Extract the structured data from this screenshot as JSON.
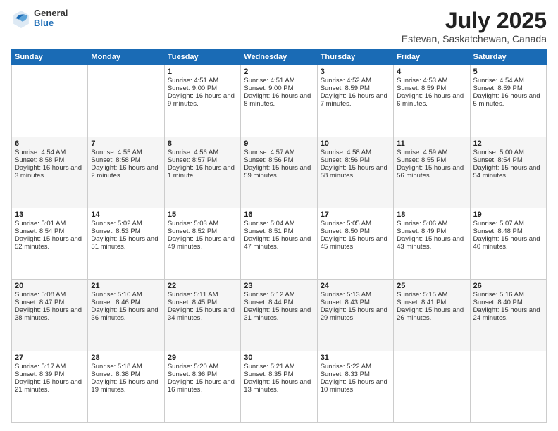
{
  "logo": {
    "general": "General",
    "blue": "Blue"
  },
  "title": "July 2025",
  "subtitle": "Estevan, Saskatchewan, Canada",
  "days_header": [
    "Sunday",
    "Monday",
    "Tuesday",
    "Wednesday",
    "Thursday",
    "Friday",
    "Saturday"
  ],
  "weeks": [
    [
      {
        "day": "",
        "info": ""
      },
      {
        "day": "",
        "info": ""
      },
      {
        "day": "1",
        "info": "Sunrise: 4:51 AM\nSunset: 9:00 PM\nDaylight: 16 hours and 9 minutes."
      },
      {
        "day": "2",
        "info": "Sunrise: 4:51 AM\nSunset: 9:00 PM\nDaylight: 16 hours and 8 minutes."
      },
      {
        "day": "3",
        "info": "Sunrise: 4:52 AM\nSunset: 8:59 PM\nDaylight: 16 hours and 7 minutes."
      },
      {
        "day": "4",
        "info": "Sunrise: 4:53 AM\nSunset: 8:59 PM\nDaylight: 16 hours and 6 minutes."
      },
      {
        "day": "5",
        "info": "Sunrise: 4:54 AM\nSunset: 8:59 PM\nDaylight: 16 hours and 5 minutes."
      }
    ],
    [
      {
        "day": "6",
        "info": "Sunrise: 4:54 AM\nSunset: 8:58 PM\nDaylight: 16 hours and 3 minutes."
      },
      {
        "day": "7",
        "info": "Sunrise: 4:55 AM\nSunset: 8:58 PM\nDaylight: 16 hours and 2 minutes."
      },
      {
        "day": "8",
        "info": "Sunrise: 4:56 AM\nSunset: 8:57 PM\nDaylight: 16 hours and 1 minute."
      },
      {
        "day": "9",
        "info": "Sunrise: 4:57 AM\nSunset: 8:56 PM\nDaylight: 15 hours and 59 minutes."
      },
      {
        "day": "10",
        "info": "Sunrise: 4:58 AM\nSunset: 8:56 PM\nDaylight: 15 hours and 58 minutes."
      },
      {
        "day": "11",
        "info": "Sunrise: 4:59 AM\nSunset: 8:55 PM\nDaylight: 15 hours and 56 minutes."
      },
      {
        "day": "12",
        "info": "Sunrise: 5:00 AM\nSunset: 8:54 PM\nDaylight: 15 hours and 54 minutes."
      }
    ],
    [
      {
        "day": "13",
        "info": "Sunrise: 5:01 AM\nSunset: 8:54 PM\nDaylight: 15 hours and 52 minutes."
      },
      {
        "day": "14",
        "info": "Sunrise: 5:02 AM\nSunset: 8:53 PM\nDaylight: 15 hours and 51 minutes."
      },
      {
        "day": "15",
        "info": "Sunrise: 5:03 AM\nSunset: 8:52 PM\nDaylight: 15 hours and 49 minutes."
      },
      {
        "day": "16",
        "info": "Sunrise: 5:04 AM\nSunset: 8:51 PM\nDaylight: 15 hours and 47 minutes."
      },
      {
        "day": "17",
        "info": "Sunrise: 5:05 AM\nSunset: 8:50 PM\nDaylight: 15 hours and 45 minutes."
      },
      {
        "day": "18",
        "info": "Sunrise: 5:06 AM\nSunset: 8:49 PM\nDaylight: 15 hours and 43 minutes."
      },
      {
        "day": "19",
        "info": "Sunrise: 5:07 AM\nSunset: 8:48 PM\nDaylight: 15 hours and 40 minutes."
      }
    ],
    [
      {
        "day": "20",
        "info": "Sunrise: 5:08 AM\nSunset: 8:47 PM\nDaylight: 15 hours and 38 minutes."
      },
      {
        "day": "21",
        "info": "Sunrise: 5:10 AM\nSunset: 8:46 PM\nDaylight: 15 hours and 36 minutes."
      },
      {
        "day": "22",
        "info": "Sunrise: 5:11 AM\nSunset: 8:45 PM\nDaylight: 15 hours and 34 minutes."
      },
      {
        "day": "23",
        "info": "Sunrise: 5:12 AM\nSunset: 8:44 PM\nDaylight: 15 hours and 31 minutes."
      },
      {
        "day": "24",
        "info": "Sunrise: 5:13 AM\nSunset: 8:43 PM\nDaylight: 15 hours and 29 minutes."
      },
      {
        "day": "25",
        "info": "Sunrise: 5:15 AM\nSunset: 8:41 PM\nDaylight: 15 hours and 26 minutes."
      },
      {
        "day": "26",
        "info": "Sunrise: 5:16 AM\nSunset: 8:40 PM\nDaylight: 15 hours and 24 minutes."
      }
    ],
    [
      {
        "day": "27",
        "info": "Sunrise: 5:17 AM\nSunset: 8:39 PM\nDaylight: 15 hours and 21 minutes."
      },
      {
        "day": "28",
        "info": "Sunrise: 5:18 AM\nSunset: 8:38 PM\nDaylight: 15 hours and 19 minutes."
      },
      {
        "day": "29",
        "info": "Sunrise: 5:20 AM\nSunset: 8:36 PM\nDaylight: 15 hours and 16 minutes."
      },
      {
        "day": "30",
        "info": "Sunrise: 5:21 AM\nSunset: 8:35 PM\nDaylight: 15 hours and 13 minutes."
      },
      {
        "day": "31",
        "info": "Sunrise: 5:22 AM\nSunset: 8:33 PM\nDaylight: 15 hours and 10 minutes."
      },
      {
        "day": "",
        "info": ""
      },
      {
        "day": "",
        "info": ""
      }
    ]
  ]
}
